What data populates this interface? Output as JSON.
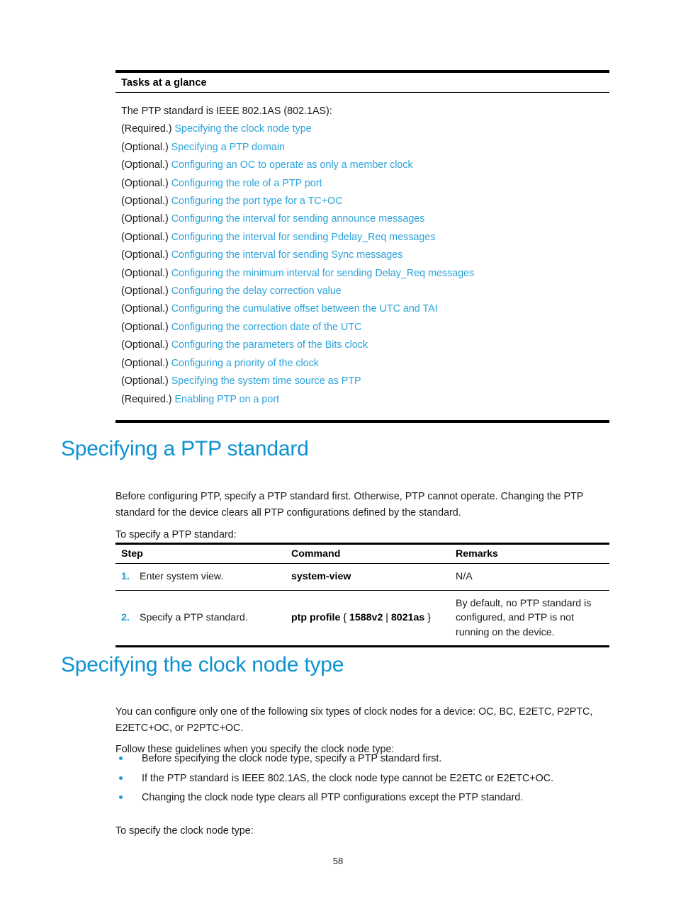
{
  "tasks_table": {
    "header": "Tasks at a glance",
    "intro": "The PTP standard is IEEE 802.1AS (802.1AS):",
    "items": [
      {
        "prefix": "(Required.)",
        "link": "Specifying the clock node type"
      },
      {
        "prefix": "(Optional.)",
        "link": "Specifying a PTP domain"
      },
      {
        "prefix": "(Optional.)",
        "link": "Configuring an OC to operate as only a member clock"
      },
      {
        "prefix": "(Optional.)",
        "link": "Configuring the role of a PTP port"
      },
      {
        "prefix": "(Optional.)",
        "link": "Configuring the port type for a TC+OC"
      },
      {
        "prefix": "(Optional.)",
        "link": "Configuring the interval for sending announce messages"
      },
      {
        "prefix": "(Optional.)",
        "link": "Configuring the interval for sending Pdelay_Req messages"
      },
      {
        "prefix": "(Optional.)",
        "link": "Configuring the interval for sending Sync messages"
      },
      {
        "prefix": "(Optional.)",
        "link": "Configuring the minimum interval for sending Delay_Req messages"
      },
      {
        "prefix": "(Optional.)",
        "link": "Configuring the delay correction value"
      },
      {
        "prefix": "(Optional.)",
        "link": "Configuring the cumulative offset between the UTC and TAI"
      },
      {
        "prefix": "(Optional.)",
        "link": "Configuring the correction date of the UTC"
      },
      {
        "prefix": "(Optional.)",
        "link": "Configuring the parameters of the Bits clock"
      },
      {
        "prefix": "(Optional.)",
        "link": "Configuring a priority of the clock"
      },
      {
        "prefix": "(Optional.)",
        "link": "Specifying the system time source as PTP"
      },
      {
        "prefix": "(Required.)",
        "link": "Enabling PTP on a port"
      }
    ]
  },
  "section_ptp_standard": {
    "title": "Specifying a PTP standard",
    "paragraph_1": "Before configuring PTP, specify a PTP standard first. Otherwise, PTP cannot operate. Changing the PTP standard for the device clears all PTP configurations defined by the standard.",
    "paragraph_2": "To specify a PTP standard:",
    "table": {
      "columns": [
        "Step",
        "Command",
        "Remarks"
      ],
      "rows": [
        {
          "num": "1.",
          "step": "Enter system view.",
          "command": "system-view",
          "command_prefix": "system-view",
          "command_args": "",
          "remarks": "N/A"
        },
        {
          "num": "2.",
          "step": "Specify a PTP standard.",
          "command": "ptp profile { 1588v2 | 8021as }",
          "command_prefix": "ptp profile",
          "command_args": "{ 1588v2 | 8021as }",
          "remarks": "By default, no PTP standard is configured, and PTP is not running on the device."
        }
      ]
    }
  },
  "section_clock_node": {
    "title": "Specifying the clock node type",
    "paragraph_1": "You can configure only one of the following six types of clock nodes for a device: OC, BC, E2ETC, P2PTC, E2ETC+OC, or P2PTC+OC.",
    "paragraph_2": "Follow these guidelines when you specify the clock node type:",
    "guidelines": [
      "Before specifying the clock node type, specify a PTP standard first.",
      "If the PTP standard is IEEE 802.1AS, the clock node type cannot be E2ETC or E2ETC+OC.",
      "Changing the clock node type clears all PTP configurations except the PTP standard."
    ],
    "paragraph_3": "To specify the clock node type:"
  },
  "footer": {
    "page_number": "58"
  },
  "colors": {
    "link": "#2ba3da",
    "heading": "#0d92d2",
    "accent": "#1c9ad6",
    "text": "#1a1a1a",
    "rule": "#000000"
  }
}
